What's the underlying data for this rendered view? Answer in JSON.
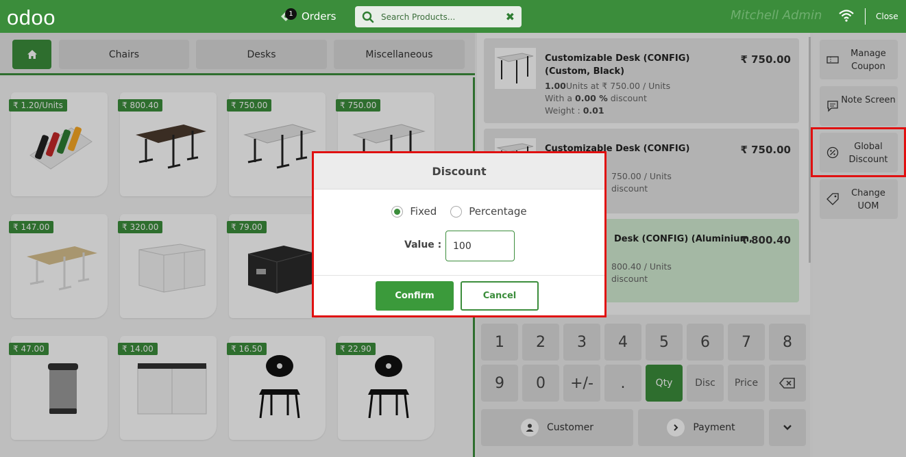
{
  "header": {
    "logo": "odoo",
    "orders_label": "Orders",
    "orders_count": "1",
    "search_placeholder": "Search Products...",
    "cashier": "Mitchell Admin",
    "close_label": "Close"
  },
  "categories": [
    "Chairs",
    "Desks",
    "Miscellaneous"
  ],
  "products": [
    {
      "price": "₹ 1.20/Units"
    },
    {
      "price": "₹ 800.40"
    },
    {
      "price": "₹ 750.00"
    },
    {
      "price": "₹ 750.00"
    },
    {
      "price": "₹ 147.00"
    },
    {
      "price": "₹ 320.00"
    },
    {
      "price": "₹ 79.00"
    },
    {
      "price": "₹ 47.00"
    },
    {
      "price": "₹ 14.00"
    },
    {
      "price": "₹ 16.50"
    },
    {
      "price": "₹ 22.90"
    }
  ],
  "order_lines": [
    {
      "name": "Customizable Desk (CONFIG) (Custom, Black)",
      "amount": "₹ 750.00",
      "qty": "1.00",
      "qty_text": "Units at ₹ 750.00 / Units",
      "disc_pre": "With a ",
      "disc_val": "0.00 %",
      "disc_post": " discount",
      "weight_pre": "Weight : ",
      "weight_val": "0.01"
    },
    {
      "name": "Customizable Desk (CONFIG) (Custom,",
      "amount": "₹ 750.00",
      "qty_text": "750.00 / Units",
      "disc_post": "discount"
    },
    {
      "name": "Desk (CONFIG) (Aluminium,",
      "amount": "₹ 800.40",
      "qty_text": "800.40 / Units",
      "disc_post": "discount"
    }
  ],
  "numpad": {
    "row1": [
      "1",
      "2",
      "3",
      "4",
      "5",
      "6",
      "7",
      "8"
    ],
    "row2": [
      "9",
      "0",
      "+/-",
      ".",
      "Qty",
      "Disc",
      "Price"
    ],
    "customer": "Customer",
    "payment": "Payment"
  },
  "controls": [
    "Manage Coupon",
    "Note Screen",
    "Global Discount",
    "Change UOM"
  ],
  "dialog": {
    "title": "Discount",
    "option_fixed": "Fixed",
    "option_percentage": "Percentage",
    "selected": "Fixed",
    "value_label": "Value :",
    "value": "100",
    "confirm": "Confirm",
    "cancel": "Cancel"
  },
  "colors": {
    "brand": "#3b8d3b",
    "highlight": "#e01010"
  }
}
